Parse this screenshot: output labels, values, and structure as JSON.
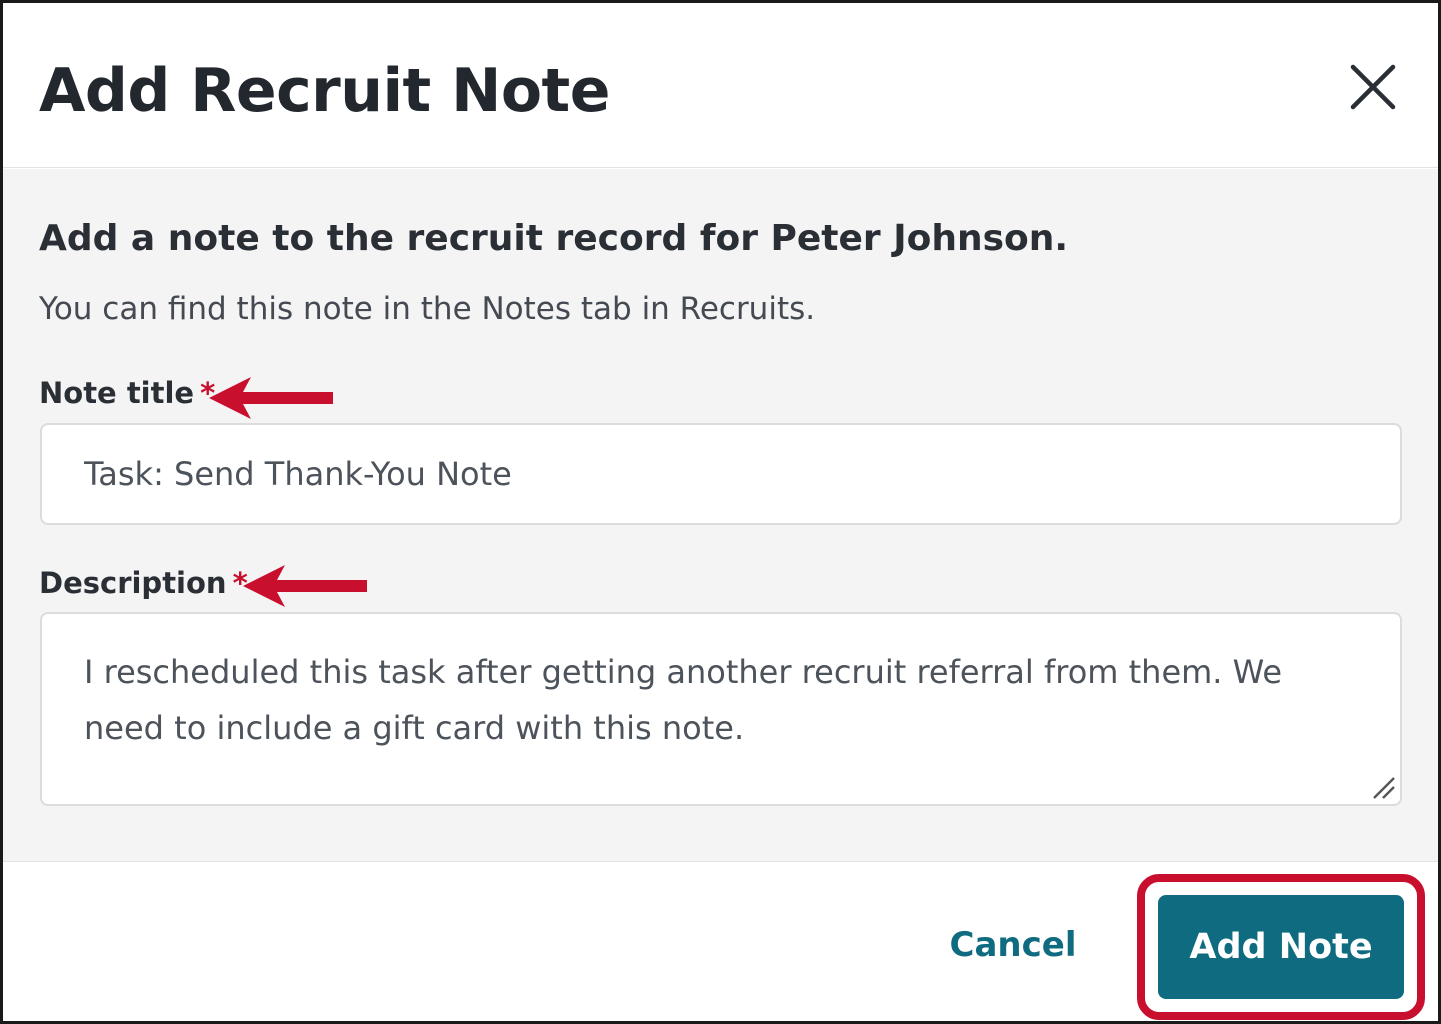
{
  "dialog": {
    "title": "Add Recruit Note",
    "subtitle": "Add a note to the recruit record for Peter Johnson.",
    "helper_text": "You can find this note in the Notes tab in Recruits."
  },
  "fields": {
    "note_title": {
      "label": "Note title",
      "required_marker": "*",
      "value": "Task: Send Thank-You Note"
    },
    "description": {
      "label": "Description",
      "required_marker": "*",
      "value": "I rescheduled this task after getting another recruit referral from them. We need to include a gift card with this note."
    }
  },
  "footer": {
    "cancel_label": "Cancel",
    "submit_label": "Add Note"
  },
  "colors": {
    "primary": "#0e6b80",
    "annotation_red": "#c8102e",
    "body_background": "#f4f4f4"
  },
  "icons": {
    "close": "close-icon",
    "resize": "resize-handle-icon",
    "annotation_arrow": "arrow-left-icon"
  }
}
